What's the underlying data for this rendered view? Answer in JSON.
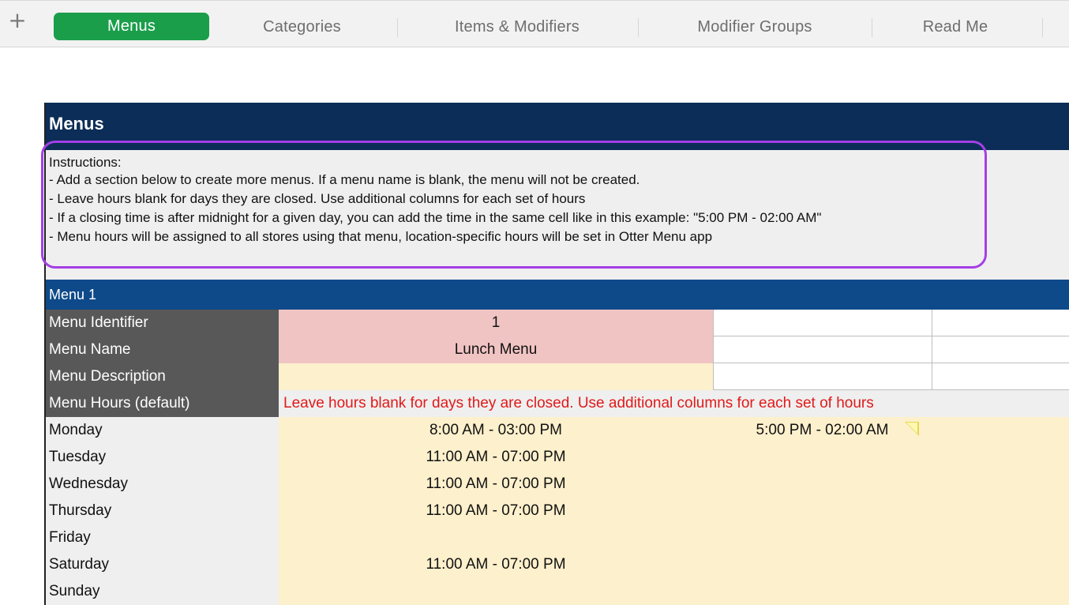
{
  "tabs": [
    {
      "label": "Menus",
      "active": true
    },
    {
      "label": "Categories",
      "active": false
    },
    {
      "label": "Items & Modifiers",
      "active": false
    },
    {
      "label": "Modifier Groups",
      "active": false
    },
    {
      "label": "Read Me",
      "active": false
    }
  ],
  "add_tab_symbol": "+",
  "sheet": {
    "title": "Menus",
    "instructions": [
      "Instructions:",
      "- Add a section below to create more menus. If a menu name is blank, the menu will not be created.",
      "- Leave hours blank for days they are closed. Use additional columns for each set of hours",
      "- If a closing time is after midnight for a given day, you can add the time in the same cell like in this example: \"5:00 PM - 02:00 AM\"",
      "- Menu hours will be assigned to all stores using that menu, location-specific hours will be set in Otter Menu app"
    ],
    "menu_section": "Menu 1",
    "fields": {
      "identifier_label": "Menu Identifier",
      "identifier_value": "1",
      "name_label": "Menu Name",
      "name_value": "Lunch Menu",
      "description_label": "Menu Description",
      "description_value": "",
      "hours_label": "Menu Hours (default)",
      "hours_note": "Leave hours blank for days they are closed. Use additional columns for each set of hours"
    },
    "days": [
      {
        "day": "Monday",
        "hours1": "8:00 AM - 03:00 PM",
        "hours2": "5:00 PM - 02:00 AM"
      },
      {
        "day": "Tuesday",
        "hours1": "11:00 AM - 07:00 PM",
        "hours2": ""
      },
      {
        "day": "Wednesday",
        "hours1": "11:00 AM - 07:00 PM",
        "hours2": ""
      },
      {
        "day": "Thursday",
        "hours1": "11:00 AM - 07:00 PM",
        "hours2": ""
      },
      {
        "day": "Friday",
        "hours1": "",
        "hours2": ""
      },
      {
        "day": "Saturday",
        "hours1": "11:00 AM - 07:00 PM",
        "hours2": ""
      },
      {
        "day": "Sunday",
        "hours1": "",
        "hours2": ""
      }
    ]
  },
  "colors": {
    "active_tab": "#1a9e4a",
    "title_bar": "#0c2d57",
    "section_bar": "#0e4a8a",
    "label_dark": "#585858",
    "pink_cell": "#f1c4c4",
    "yellow_cell": "#fdf0cc",
    "note_text": "#e01a1a",
    "highlight_outline": "#a43fe6"
  }
}
